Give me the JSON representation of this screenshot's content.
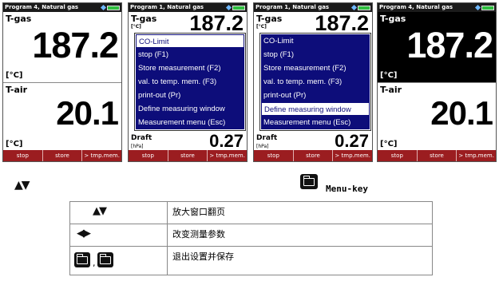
{
  "screens": [
    {
      "title": "Program 4, Natural gas",
      "inverted_top": false,
      "top_label": "T-gas",
      "top_value": "187.2",
      "top_unit": "[°C]",
      "bottom_label": "T-air",
      "bottom_value": "20.1",
      "bottom_unit": "[°C]",
      "func_keys": [
        "stop",
        "store",
        "> tmp.mem."
      ]
    },
    {
      "title": "Program 1, Natural gas",
      "top_label": "T-gas",
      "top_value": "187.2",
      "top_unit": "[°C]",
      "draft_label": "Draft",
      "draft_value": "0.27",
      "draft_unit": "[hPa]",
      "menu": [
        "CO-Limit",
        "stop (F1)",
        "Store measurement (F2)",
        "val. to temp. mem. (F3)",
        "print-out (Pr)",
        "Define measuring window",
        "Measurement menu (Esc)"
      ],
      "selected_index": 0,
      "func_keys": [
        "stop",
        "store",
        "> tmp.mem."
      ]
    },
    {
      "title": "Program 1, Natural gas",
      "top_label": "T-gas",
      "top_value": "187.2",
      "top_unit": "[°C]",
      "draft_label": "Draft",
      "draft_value": "0.27",
      "draft_unit": "[hPa]",
      "menu": [
        "CO-Limit",
        "stop (F1)",
        "Store measurement (F2)",
        "val. to temp. mem. (F3)",
        "print-out (Pr)",
        "Define measuring window",
        "Measurement menu (Esc)"
      ],
      "selected_index": 5,
      "func_keys": [
        "stop",
        "store",
        "> tmp.mem."
      ]
    },
    {
      "title": "Program 4, Natural gas",
      "inverted_top": true,
      "top_label": "T-gas",
      "top_value": "187.2",
      "top_unit": "[°C]",
      "bottom_label": "T-air",
      "bottom_value": "20.1",
      "bottom_unit": "[°C]",
      "func_keys": [
        "stop",
        "store",
        "> tmp.mem."
      ]
    }
  ],
  "legend": {
    "updown_glyph": "▲▼",
    "menu_key_label": "Menu-key"
  },
  "table": {
    "rows": [
      {
        "key_icon": "up-down-arrows",
        "key_glyph": "▲▼",
        "desc": "放大窗口翻页"
      },
      {
        "key_icon": "left-right-arrows",
        "key_glyph": "◀▶",
        "desc": "改变测量参数"
      },
      {
        "key_icon": "folder-keys",
        "key_sep": ",",
        "desc": "退出设置并保存"
      }
    ]
  }
}
